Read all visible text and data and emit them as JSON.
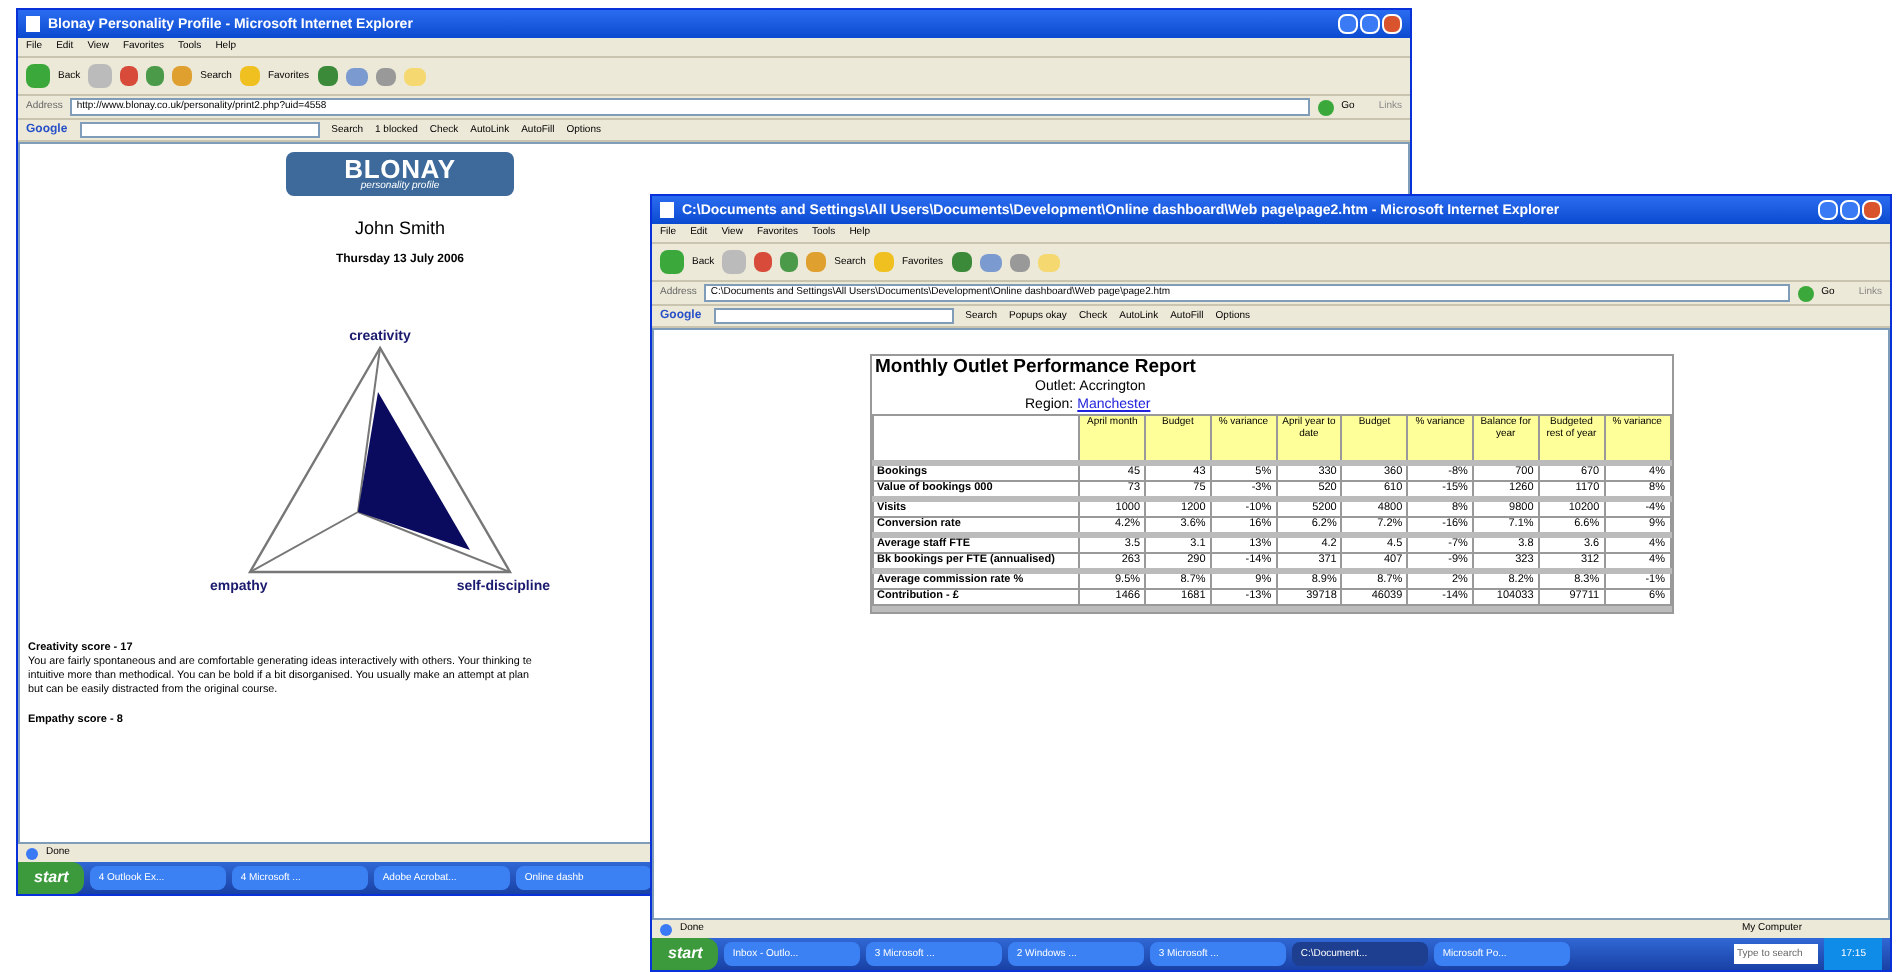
{
  "windows": [
    {
      "title": "Blonay Personality Profile - Microsoft Internet Explorer",
      "menu": [
        "File",
        "Edit",
        "View",
        "Favorites",
        "Tools",
        "Help"
      ],
      "toolbar": [
        "Back",
        "Search",
        "Favorites"
      ],
      "address": {
        "label": "Address",
        "value": "http://www.blonay.co.uk/personality/print2.php?uid=4558",
        "go": "Go",
        "links": "Links"
      },
      "google_bar": {
        "brand": "Google",
        "items": [
          "Search",
          "1 blocked",
          "Check",
          "AutoLink",
          "AutoFill",
          "Options"
        ]
      },
      "page": {
        "kind": "profile",
        "logo": {
          "name": "BLONAY",
          "tagline": "personality profile"
        },
        "person": "John Smith",
        "date": "Thursday 13 July 2006",
        "radar_labels": {
          "top": "creativity",
          "left": "empathy",
          "right": "self-discipline"
        },
        "score_title": "Creativity score - 17",
        "score_lines": [
          "You are fairly spontaneous and are comfortable generating ideas interactively with others. Your thinking te",
          "intuitive more than methodical. You can be bold if a bit disorganised. You usually make an attempt at plan",
          "but can be easily distracted from the original course."
        ],
        "next_title": "Empathy score - 8"
      },
      "status": {
        "left": "Done"
      },
      "taskbar": {
        "start": "start",
        "items": [
          {
            "label": "4 Outlook Ex...",
            "selected": false
          },
          {
            "label": "4 Microsoft ...",
            "selected": false
          },
          {
            "label": "Adobe Acrobat...",
            "selected": false
          },
          {
            "label": "Online dashb",
            "selected": false
          }
        ]
      }
    },
    {
      "title": "C:\\Documents and Settings\\All Users\\Documents\\Development\\Online dashboard\\Web page\\page2.htm - Microsoft Internet Explorer",
      "menu": [
        "File",
        "Edit",
        "View",
        "Favorites",
        "Tools",
        "Help"
      ],
      "toolbar": [
        "Back",
        "Search",
        "Favorites"
      ],
      "address": {
        "label": "Address",
        "value": "C:\\Documents and Settings\\All Users\\Documents\\Development\\Online dashboard\\Web page\\page2.htm",
        "go": "Go",
        "links": "Links"
      },
      "google_bar": {
        "brand": "Google",
        "items": [
          "Search",
          "Popups okay",
          "Check",
          "AutoLink",
          "AutoFill",
          "Options"
        ]
      },
      "page": {
        "kind": "report",
        "title": "Monthly Outlet Performance Report",
        "outlet": "Outlet: Accrington",
        "region_label": "Region:",
        "region_link": "Manchester",
        "columns": [
          "April month",
          "Budget",
          "% variance",
          "April year to date",
          "Budget",
          "% variance",
          "Balance for year",
          "Budgeted rest of year",
          "% variance"
        ],
        "groups": [
          {
            "rows": [
              {
                "label": "Bookings",
                "values": [
                  "45",
                  "43",
                  "5%",
                  "330",
                  "360",
                  "-8%",
                  "700",
                  "670",
                  "4%"
                ]
              },
              {
                "label": "Value of bookings 000",
                "values": [
                  "73",
                  "75",
                  "-3%",
                  "520",
                  "610",
                  "-15%",
                  "1260",
                  "1170",
                  "8%"
                ]
              }
            ]
          },
          {
            "rows": [
              {
                "label": "Visits",
                "values": [
                  "1000",
                  "1200",
                  "-10%",
                  "5200",
                  "4800",
                  "8%",
                  "9800",
                  "10200",
                  "-4%"
                ]
              },
              {
                "label": "Conversion rate",
                "values": [
                  "4.2%",
                  "3.6%",
                  "16%",
                  "6.2%",
                  "7.2%",
                  "-16%",
                  "7.1%",
                  "6.6%",
                  "9%"
                ]
              }
            ]
          },
          {
            "rows": [
              {
                "label": "Average staff FTE",
                "values": [
                  "3.5",
                  "3.1",
                  "13%",
                  "4.2",
                  "4.5",
                  "-7%",
                  "3.8",
                  "3.6",
                  "4%"
                ]
              },
              {
                "label": "Bk bookings per FTE (annualised)",
                "values": [
                  "263",
                  "290",
                  "-14%",
                  "371",
                  "407",
                  "-9%",
                  "323",
                  "312",
                  "4%"
                ]
              }
            ]
          },
          {
            "rows": [
              {
                "label": "Average commission rate %",
                "values": [
                  "9.5%",
                  "8.7%",
                  "9%",
                  "8.9%",
                  "8.7%",
                  "2%",
                  "8.2%",
                  "8.3%",
                  "-1%"
                ]
              },
              {
                "label": "Contribution - £",
                "values": [
                  "1466",
                  "1681",
                  "-13%",
                  "39718",
                  "46039",
                  "-14%",
                  "104033",
                  "97711",
                  "6%"
                ]
              }
            ]
          }
        ]
      },
      "status": {
        "left": "Done",
        "right": "My Computer"
      },
      "taskbar": {
        "start": "start",
        "items": [
          {
            "label": "Inbox - Outlo...",
            "selected": false
          },
          {
            "label": "3 Microsoft ...",
            "selected": false
          },
          {
            "label": "2 Windows ...",
            "selected": false
          },
          {
            "label": "3 Microsoft ...",
            "selected": false
          },
          {
            "label": "C:\\Document...",
            "selected": true
          },
          {
            "label": "Microsoft Po...",
            "selected": false
          }
        ],
        "search_placeholder": "Type to search",
        "clock": "17:15"
      }
    }
  ]
}
